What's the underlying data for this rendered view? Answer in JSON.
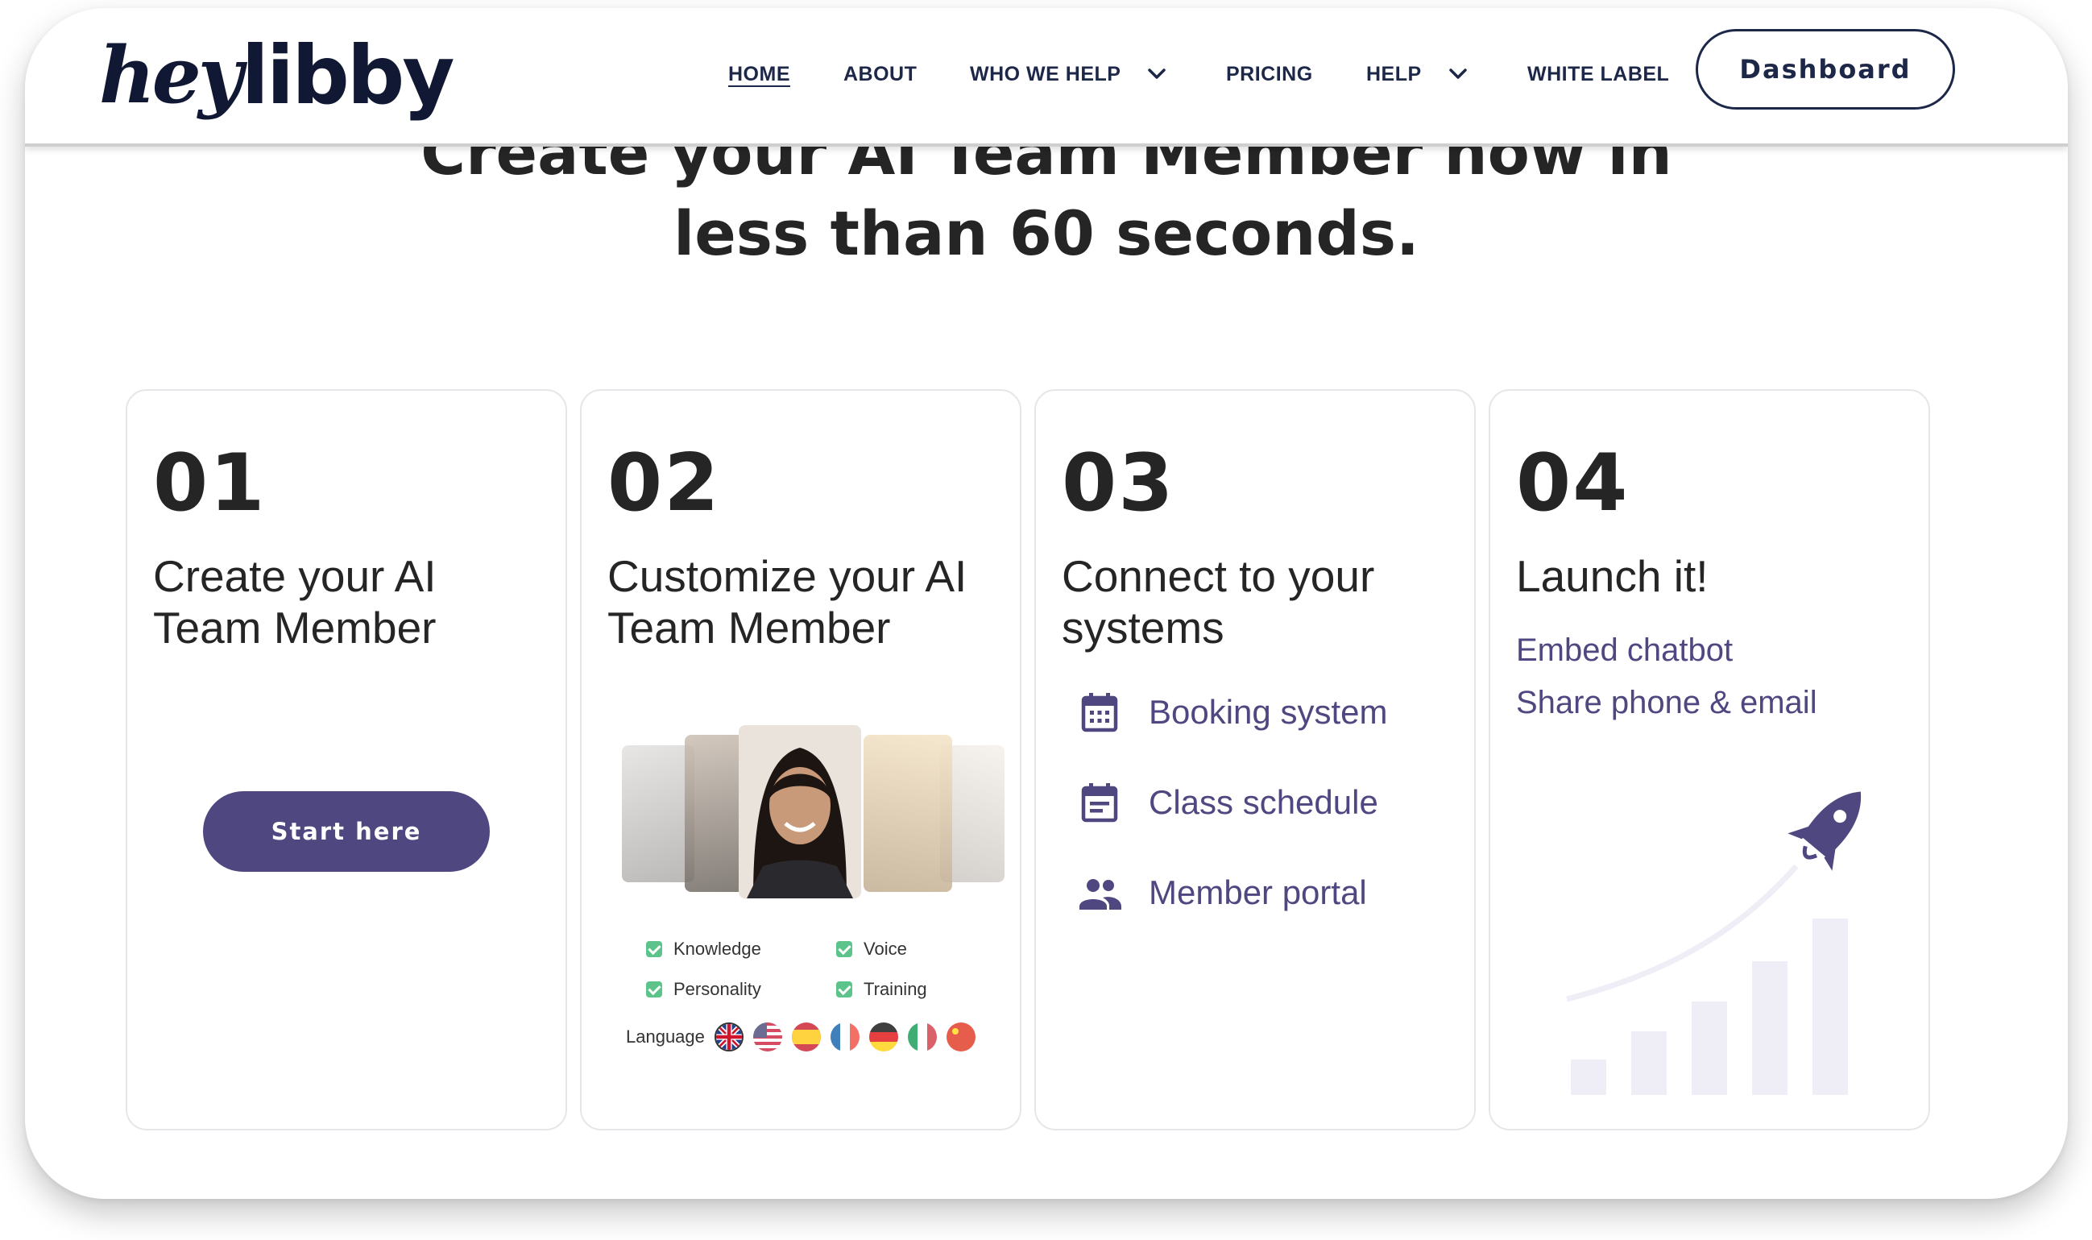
{
  "logo": {
    "part1": "hey",
    "part2": "libby"
  },
  "nav": {
    "home": "HOME",
    "about": "ABOUT",
    "who_we_help": "WHO WE HELP",
    "pricing": "PRICING",
    "help": "HELP",
    "white_label": "WHITE LABEL",
    "dashboard": "Dashboard"
  },
  "hero": {
    "line1": "Create your AI Team Member now in",
    "line2": "less than 60 seconds."
  },
  "steps": [
    {
      "number": "01",
      "title_line1": "Create your AI",
      "title_line2": "Team Member",
      "button": "Start here"
    },
    {
      "number": "02",
      "title_line1": "Customize your AI",
      "title_line2": "Team Member",
      "options": [
        "Knowledge",
        "Voice",
        "Personality",
        "Training"
      ],
      "language_label": "Language"
    },
    {
      "number": "03",
      "title_line1": "Connect to your",
      "title_line2": "systems",
      "systems": [
        "Booking system",
        "Class schedule",
        "Member portal"
      ]
    },
    {
      "number": "04",
      "title_line1": "Launch it!",
      "links": [
        "Embed chatbot",
        "Share phone & email"
      ]
    }
  ],
  "colors": {
    "brand_purple": "#4e4780",
    "navy": "#1d2748",
    "check_green": "#5cc48a"
  }
}
